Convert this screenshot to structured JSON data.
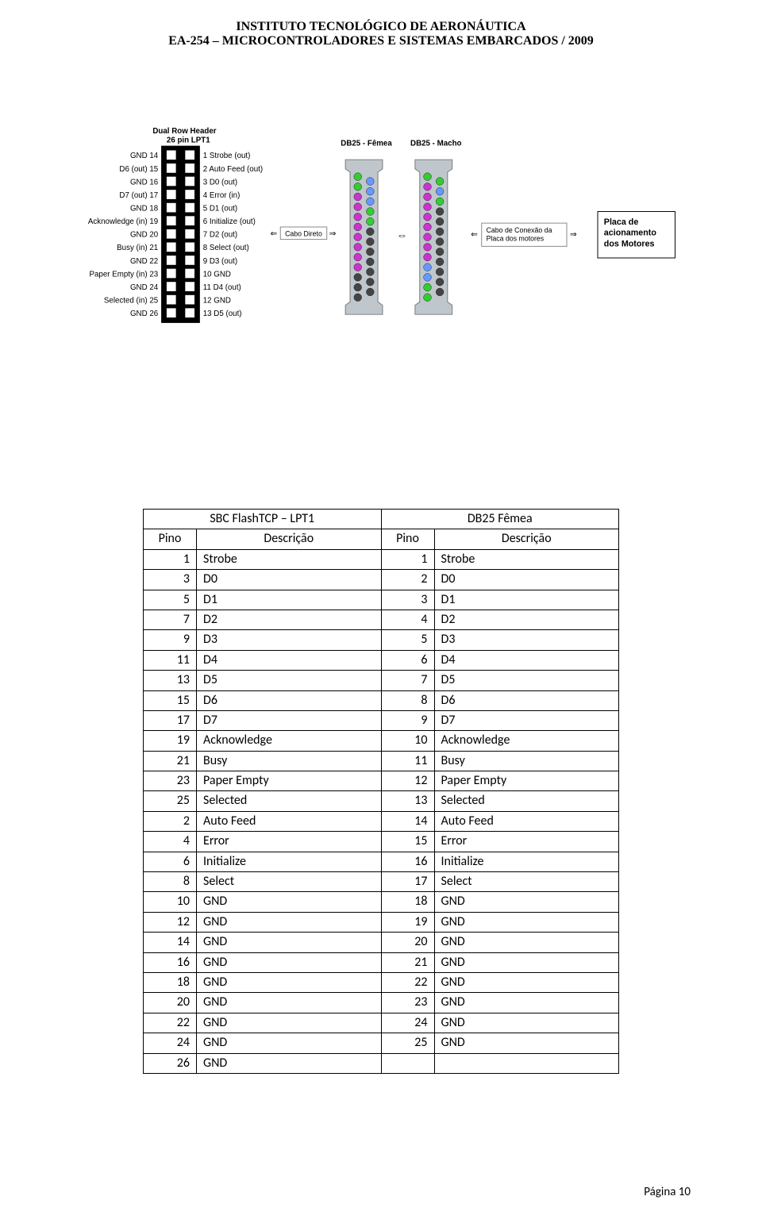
{
  "header": {
    "line1": "INSTITUTO TECNOLÓGICO DE AERONÁUTICA",
    "line2": "EA-254 – MICROCONTROLADORES E SISTEMAS EMBARCADOS / 2009"
  },
  "diagram": {
    "dualRow": {
      "title1": "Dual Row Header",
      "title2": "26 pin LPT1",
      "left": [
        {
          "n": "14",
          "lbl": "GND"
        },
        {
          "n": "15",
          "lbl": "D6 (out)"
        },
        {
          "n": "16",
          "lbl": "GND"
        },
        {
          "n": "17",
          "lbl": "D7 (out)"
        },
        {
          "n": "18",
          "lbl": "GND"
        },
        {
          "n": "19",
          "lbl": "Acknowledge (in)"
        },
        {
          "n": "20",
          "lbl": "GND"
        },
        {
          "n": "21",
          "lbl": "Busy (in)"
        },
        {
          "n": "22",
          "lbl": "GND"
        },
        {
          "n": "23",
          "lbl": "Paper Empty (in)"
        },
        {
          "n": "24",
          "lbl": "GND"
        },
        {
          "n": "25",
          "lbl": "Selected (in)"
        },
        {
          "n": "26",
          "lbl": "GND"
        }
      ],
      "right": [
        {
          "n": "1",
          "lbl": "Strobe (out)"
        },
        {
          "n": "2",
          "lbl": "Auto Feed (out)"
        },
        {
          "n": "3",
          "lbl": "D0 (out)"
        },
        {
          "n": "4",
          "lbl": "Error (in)"
        },
        {
          "n": "5",
          "lbl": "D1 (out)"
        },
        {
          "n": "6",
          "lbl": "Initialize (out)"
        },
        {
          "n": "7",
          "lbl": "D2 (out)"
        },
        {
          "n": "8",
          "lbl": "Select (out)"
        },
        {
          "n": "9",
          "lbl": "D3 (out)"
        },
        {
          "n": "10",
          "lbl": "GND"
        },
        {
          "n": "11",
          "lbl": "D4 (out)"
        },
        {
          "n": "12",
          "lbl": "GND"
        },
        {
          "n": "13",
          "lbl": "D5 (out)"
        }
      ]
    },
    "caboDireto": "Cabo Direto",
    "db25Femea": "DB25 - Fêmea",
    "db25Macho": "DB25 - Macho",
    "caboConexao1": "Cabo de Conexão da",
    "caboConexao2": "Placa  dos motores",
    "placa1": "Placa de",
    "placa2": "acionamento",
    "placa3": "dos Motores",
    "db25_female_colors": [
      [
        "#33cc33",
        "#33cc33",
        "#cc33cc",
        "#cc33cc",
        "#cc33cc",
        "#cc33cc",
        "#cc33cc",
        "#cc33cc",
        "#cc33cc",
        "#cc33cc",
        "#444",
        "#444",
        "#444"
      ],
      [
        "#6699ff",
        "#6699ff",
        "#6699ff",
        "#33cc33",
        "#33cc33",
        "#444",
        "#444",
        "#444",
        "#444",
        "#444",
        "#444",
        "#444"
      ]
    ],
    "db25_male_colors": [
      [
        "#33cc33",
        "#cc33cc",
        "#cc33cc",
        "#cc33cc",
        "#cc33cc",
        "#cc33cc",
        "#cc33cc",
        "#cc33cc",
        "#cc33cc",
        "#6699ff",
        "#6699ff",
        "#33cc33",
        "#33cc33"
      ],
      [
        "#33cc33",
        "#6699ff",
        "#33cc33",
        "#444",
        "#444",
        "#444",
        "#444",
        "#444",
        "#444",
        "#444",
        "#444",
        "#444"
      ]
    ]
  },
  "table": {
    "topHeaders": [
      "SBC FlashTCP – LPT1",
      "DB25 Fêmea"
    ],
    "colHeaders": [
      "Pino",
      "Descrição",
      "Pino",
      "Descrição"
    ],
    "rows": [
      [
        "1",
        "Strobe",
        "1",
        "Strobe"
      ],
      [
        "3",
        "D0",
        "2",
        "D0"
      ],
      [
        "5",
        "D1",
        "3",
        "D1"
      ],
      [
        "7",
        "D2",
        "4",
        "D2"
      ],
      [
        "9",
        "D3",
        "5",
        "D3"
      ],
      [
        "11",
        "D4",
        "6",
        "D4"
      ],
      [
        "13",
        "D5",
        "7",
        "D5"
      ],
      [
        "15",
        "D6",
        "8",
        "D6"
      ],
      [
        "17",
        "D7",
        "9",
        "D7"
      ],
      [
        "19",
        "Acknowledge",
        "10",
        "Acknowledge"
      ],
      [
        "21",
        "Busy",
        "11",
        "Busy"
      ],
      [
        "23",
        "Paper Empty",
        "12",
        "Paper Empty"
      ],
      [
        "25",
        "Selected",
        "13",
        "Selected"
      ],
      [
        "2",
        "Auto Feed",
        "14",
        "Auto Feed"
      ],
      [
        "4",
        "Error",
        "15",
        "Error"
      ],
      [
        "6",
        "Initialize",
        "16",
        "Initialize"
      ],
      [
        "8",
        "Select",
        "17",
        "Select"
      ],
      [
        "10",
        "GND",
        "18",
        "GND"
      ],
      [
        "12",
        "GND",
        "19",
        "GND"
      ],
      [
        "14",
        "GND",
        "20",
        "GND"
      ],
      [
        "16",
        "GND",
        "21",
        "GND"
      ],
      [
        "18",
        "GND",
        "22",
        "GND"
      ],
      [
        "20",
        "GND",
        "23",
        "GND"
      ],
      [
        "22",
        "GND",
        "24",
        "GND"
      ],
      [
        "24",
        "GND",
        "25",
        "GND"
      ],
      [
        "26",
        "GND",
        "",
        ""
      ]
    ]
  },
  "footer": "Página 10"
}
